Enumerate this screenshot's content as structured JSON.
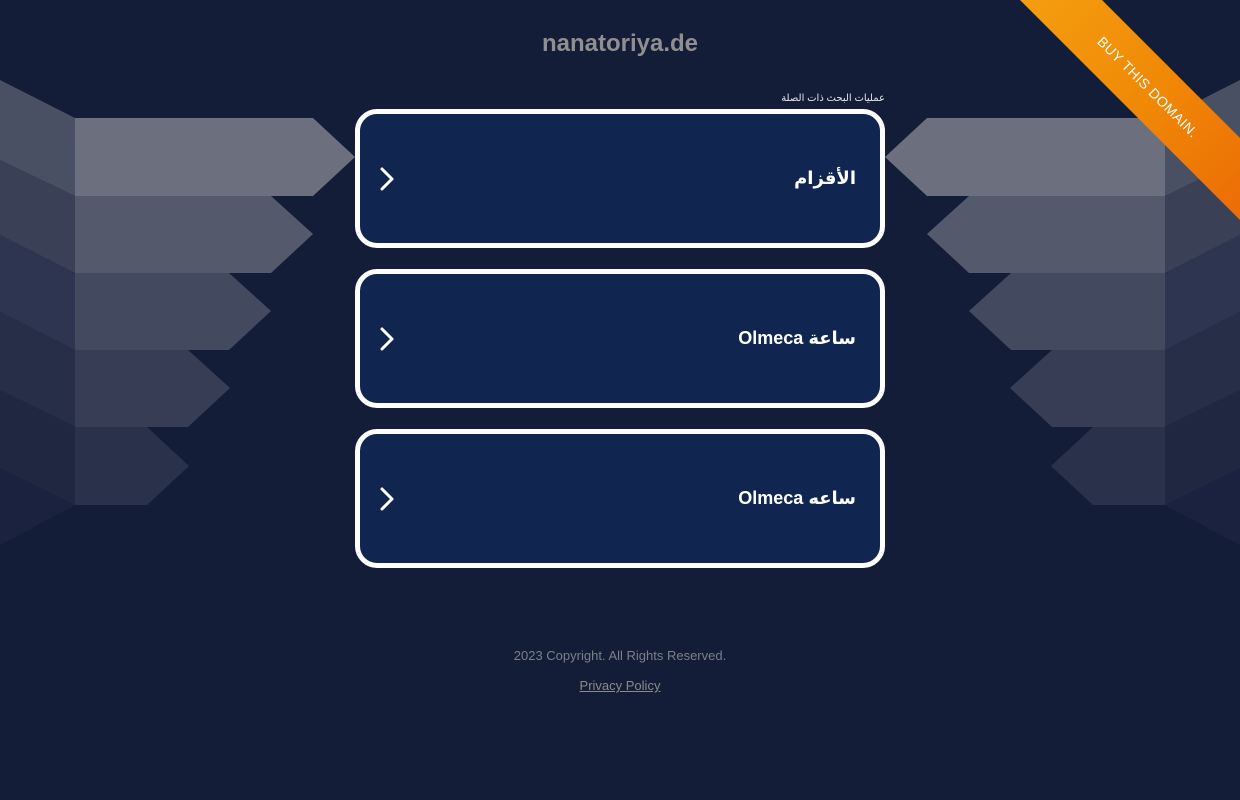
{
  "site": {
    "domain": "nanatoriya.de"
  },
  "ribbon": {
    "label": "BUY THIS DOMAIN."
  },
  "related": {
    "heading": "عمليات البحث ذات الصلة",
    "links": [
      {
        "label": "الأقزام"
      },
      {
        "label": "ساعة Olmeca"
      },
      {
        "label": "ساعه Olmeca"
      }
    ]
  },
  "footer": {
    "copyright": "2023 Copyright. All Rights Reserved.",
    "privacy": "Privacy Policy"
  },
  "colors": {
    "background": "#141d37",
    "card": "#102650",
    "card_border": "#ffffff",
    "ribbon": "#f08a06",
    "title": "#8f8f8f"
  },
  "icons": {
    "link_arrow": "chevron-right-icon"
  }
}
